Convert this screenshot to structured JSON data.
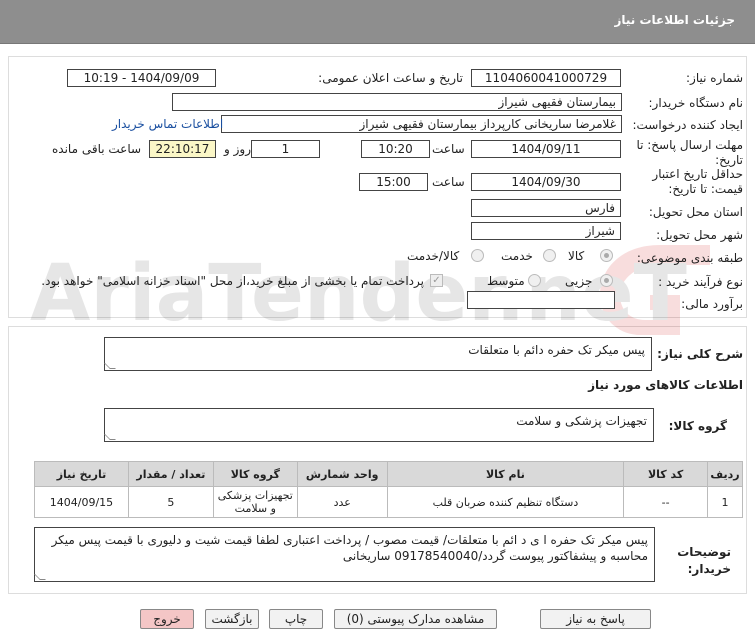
{
  "header": {
    "title": "جزئیات اطلاعات نیاز"
  },
  "form": {
    "need_number_label": "شماره نیاز:",
    "need_number": "1104060041000729",
    "announce_label": "تاریخ و ساعت اعلان عمومی:",
    "announce_value": "1404/09/09 - 10:19",
    "buyer_org_label": "نام دستگاه خریدار:",
    "buyer_org": "بیمارستان فقیهی شیراز",
    "creator_label": "ایجاد کننده درخواست:",
    "creator": "غلامرضا ساریخانی کارپرداز بیمارستان فقیهی شیراز",
    "contact_link": "اطلاعات تماس خریدار",
    "deadline_label_1": "مهلت ارسال پاسخ: تا",
    "deadline_label_2": "تاریخ:",
    "deadline_date": "1404/09/11",
    "time_label": "ساعت",
    "deadline_time": "10:20",
    "days_value": "1",
    "days_label": "روز و",
    "remaining_time": "22:10:17",
    "remaining_label": "ساعت باقی مانده",
    "validity_label_1": "حداقل تاریخ اعتبار",
    "validity_label_2": "قیمت: تا تاریخ:",
    "validity_date": "1404/09/30",
    "validity_time": "15:00",
    "province_label": "استان محل تحویل:",
    "province": "فارس",
    "city_label": "شهر محل تحویل:",
    "city": "شیراز",
    "category_label": "طبقه بندی موضوعی:",
    "category_options": [
      "کالا",
      "خدمت",
      "کالا/خدمت"
    ],
    "process_label": "نوع فرآیند خرید :",
    "process_options": [
      "جزیی",
      "متوسط"
    ],
    "payment_note": "پرداخت تمام یا بخشی از مبلغ خرید،از محل \"اسناد خزانه اسلامی\" خواهد بود.",
    "estimate_label": "برآورد مالی:",
    "estimate_value": ""
  },
  "summary": {
    "label": "شرح کلی نیاز:",
    "value": "پیس میکر تک حفره دائم با متعلقات"
  },
  "goods_section": {
    "title": "اطلاعات کالاهای مورد نیاز",
    "group_label": "گروه کالا:",
    "group_value": "تجهیزات پزشکی و سلامت"
  },
  "table": {
    "headers": [
      "ردیف",
      "کد کالا",
      "نام کالا",
      "واحد شمارش",
      "گروه کالا",
      "تعداد / مقدار",
      "تاریخ نیاز"
    ],
    "rows": [
      [
        "1",
        "--",
        "دستگاه تنظیم کننده ضربان قلب",
        "عدد",
        "تجهیزات پزشکی و سلامت",
        "5",
        "1404/09/15"
      ]
    ]
  },
  "buyer_notes": {
    "label": "توضیحات خریدار:",
    "value": "پیس میکر تک حفره ا ی د ائم با متعلقات/ قیمت مصوب / پرداخت اعتباری لطفا قیمت شیت و دلیوری با قیمت پیس میکر محاسبه و پیشفاکتور پیوست گردد/09178540040 ساریخانی"
  },
  "buttons": {
    "reply": "پاسخ به نیاز",
    "attachments": "مشاهده مدارک پیوستی (0)",
    "print": "چاپ",
    "back": "بازگشت",
    "exit": "خروج"
  },
  "watermark": {
    "text": "AriaTender.neT"
  },
  "colors": {
    "header": "#8e8e8e",
    "remaining_bg": "#fbf7c7",
    "exit_bg": "#f4c6c6",
    "link": "#1a4fa0"
  }
}
